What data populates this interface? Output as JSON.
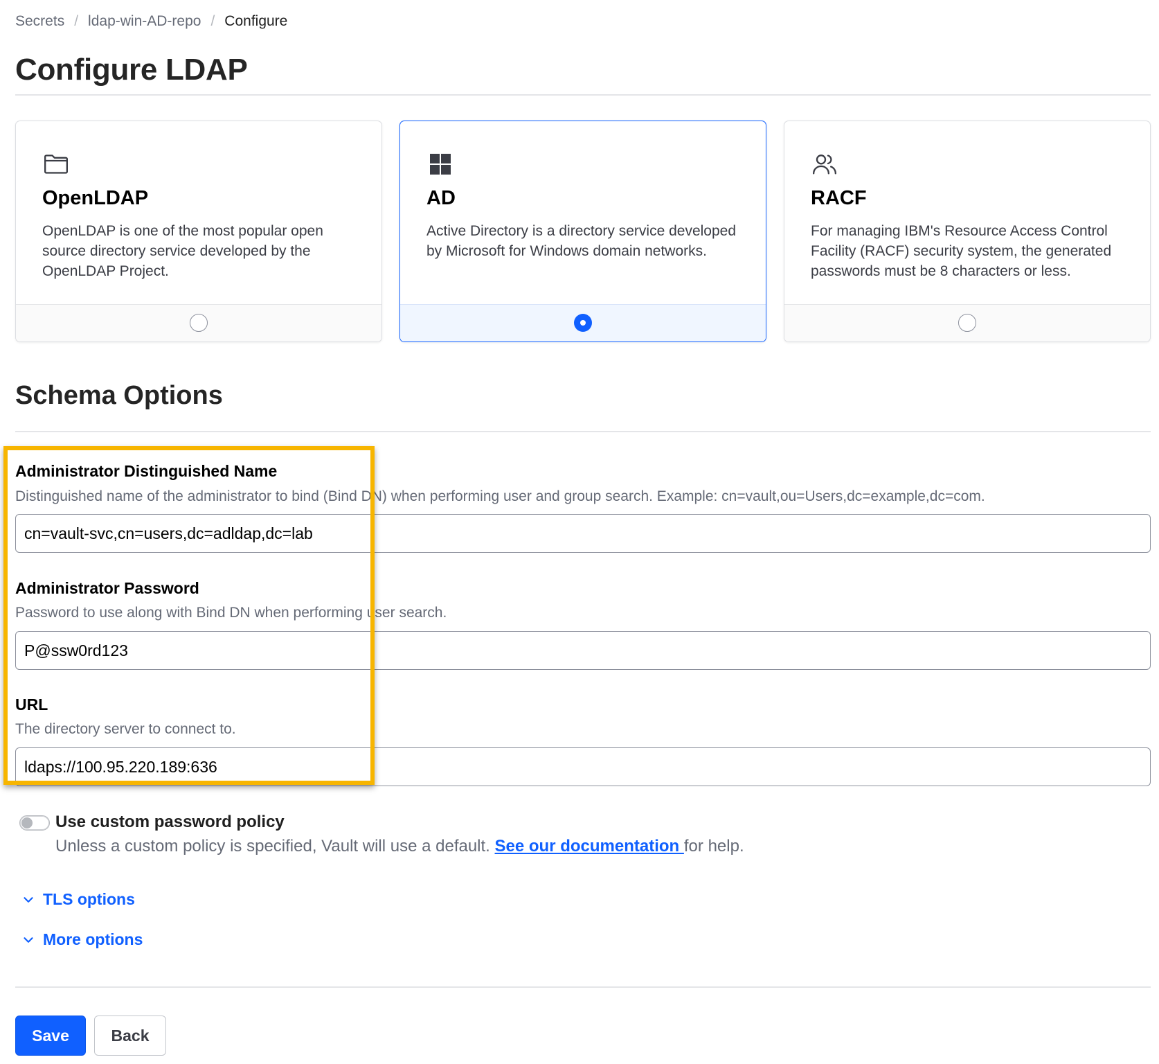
{
  "breadcrumb": [
    {
      "label": "Secrets"
    },
    {
      "label": "ldap-win-AD-repo"
    },
    {
      "label": "Configure"
    }
  ],
  "page": {
    "title": "Configure LDAP"
  },
  "cards": [
    {
      "icon": "folder-icon",
      "name": "OpenLDAP",
      "description": "OpenLDAP is one of the most popular open source directory service developed by the OpenLDAP Project.",
      "selected": false
    },
    {
      "icon": "windows-icon",
      "name": "AD",
      "description": "Active Directory is a directory service developed by Microsoft for Windows domain networks.",
      "selected": true
    },
    {
      "icon": "users-icon",
      "name": "RACF",
      "description": "For managing IBM's Resource Access Control Facility (RACF) security system, the generated passwords must be 8 characters or less.",
      "selected": false
    }
  ],
  "schema": {
    "title": "Schema Options",
    "fields": [
      {
        "label": "Administrator Distinguished Name",
        "help": "Distinguished name of the administrator to bind (Bind DN) when performing user and group search. Example: cn=vault,ou=Users,dc=example,dc=com.",
        "value": "cn=vault-svc,cn=users,dc=adldap,dc=lab"
      },
      {
        "label": "Administrator Password",
        "help": "Password to use along with Bind DN when performing user search.",
        "value": "P@ssw0rd123"
      },
      {
        "label": "URL",
        "help": "The directory server to connect to.",
        "value": "ldaps://100.95.220.189:636"
      }
    ]
  },
  "password_policy": {
    "label": "Use custom password policy",
    "help_prefix": "Unless a custom policy is specified, Vault will use a default. ",
    "link_text": "See our documentation ",
    "help_suffix": "for help.",
    "enabled": false
  },
  "disclosures": [
    {
      "label": "TLS options"
    },
    {
      "label": "More options"
    }
  ],
  "actions": {
    "save_label": "Save",
    "back_label": "Back"
  },
  "colors": {
    "accent": "#1060ff",
    "highlight": "#f7b500"
  }
}
